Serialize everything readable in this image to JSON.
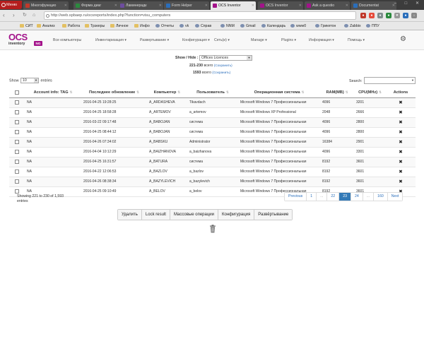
{
  "browser": {
    "menu_label": "Меню",
    "tabs": [
      {
        "title": "Многофункцио",
        "color": "#c0392b",
        "active": false
      },
      {
        "title": "Форма диаг",
        "color": "#2b8a3e",
        "active": false
      },
      {
        "title": "Ламинерадк",
        "color": "#6d4c9f",
        "active": false
      },
      {
        "title": "Form Helper",
        "color": "#2a6ebb",
        "active": false
      },
      {
        "title": "OCS Inventor",
        "color": "#a3128a",
        "active": true
      },
      {
        "title": "OCS Inventor",
        "color": "#a3128a",
        "active": false
      },
      {
        "title": "Ask a questio",
        "color": "#a3128a",
        "active": false
      },
      {
        "title": "Documentat",
        "color": "#2a6ebb",
        "active": false
      }
    ],
    "window_controls": "– □ ✕",
    "url": "http://web.spbaep.ru/ocsreports/index.php?function=visu_computers",
    "bookmarks": [
      "СИТ",
      "Анализ",
      "Работа",
      "Трэкеры",
      "Личное",
      "Инфо",
      "Отчеты",
      "vk",
      "Справ",
      "NNM",
      "Gmail",
      "Календарь",
      "www0",
      "Грикетон",
      "Zabbix",
      "ППУ"
    ]
  },
  "logo": {
    "main": "OCS",
    "sub": "inventory",
    "badge": "NG"
  },
  "nav": [
    "Все компьютеры",
    "Инвентаризация ▾",
    "Развертывание ▾",
    "Конфигурация ▾",
    "Сеть(и) ▾",
    "Manage ▾",
    "Plugins ▾",
    "Информация ▾",
    "Помощь ▾"
  ],
  "filter": {
    "show_hide_label": "Show / Hide :",
    "selected": "Offices Licences",
    "range_count": "221-230",
    "range_suffix": "всего",
    "range_save": "(Сохранить)",
    "total_count": "1593",
    "total_suffix": "всего",
    "total_save": "(Сохранить)"
  },
  "length": {
    "show": "Show",
    "value": "10",
    "entries": "entries"
  },
  "search": {
    "label": "Search:",
    "value": ""
  },
  "table": {
    "columns": [
      "Account info: TAG",
      "Последнее обновление",
      "Компьютер",
      "Пользователь",
      "Операционная система",
      "RAM(MB)",
      "CPU(MHz)",
      "Actions"
    ],
    "rows": [
      [
        "NA",
        "2016-04-25 19:28:25",
        "A_ARDASHEVA",
        "Tikavdach",
        "Microsoft Windows 7 Профессиональная",
        "4096",
        "3201"
      ],
      [
        "NA",
        "2016-04-25 18:58:28",
        "A_ARTEMOV",
        "a_artemov",
        "Microsoft Windows XP Professional",
        "2048",
        "2666"
      ],
      [
        "NA",
        "2016-03-22 09:17:48",
        "A_BABOJAN",
        "система",
        "Microsoft Windows 7 Профессиональная",
        "4096",
        "2800"
      ],
      [
        "NA",
        "2016-04-25 08:44:12",
        "A_BABOJAN",
        "система",
        "Microsoft Windows 7 Профессиональная",
        "4096",
        "2800"
      ],
      [
        "NA",
        "2016-04-26 07:34:02",
        "A_BABSKU",
        "Administrator",
        "Microsoft Windows 7 Профессиональная",
        "16384",
        "2901"
      ],
      [
        "NA",
        "2016-04-04 10:12:29",
        "A_BAIZHANOVA",
        "a_baizhanova",
        "Microsoft Windows 7 Профессиональная",
        "4096",
        "3301"
      ],
      [
        "NA",
        "2016-04-25 16:31:57",
        "A_BATURA",
        "система",
        "Microsoft Windows 7 Профессиональная",
        "8192",
        "3601"
      ],
      [
        "NA",
        "2016-04-22 12:06:53",
        "A_BAZLOV",
        "a_bazlov",
        "Microsoft Windows 7 Профессиональная",
        "8192",
        "3601"
      ],
      [
        "NA",
        "2016-04-26 08:38:34",
        "A_BAZYLEVICH",
        "a_bazylevich",
        "Microsoft Windows 7 Профессиональная",
        "8192",
        "3601"
      ],
      [
        "NA",
        "2016-04-25 09:10:49",
        "A_BELOV",
        "a_belov",
        "Microsoft Windows 7 Профессиональная",
        "8192",
        "3601"
      ]
    ],
    "action_glyph": "✖"
  },
  "info": "Showing 221 to 230 of 1,593 entries",
  "pagination": [
    "Previous",
    "1",
    "...",
    "22",
    "23",
    "24",
    "...",
    "160",
    "Next"
  ],
  "pagination_active": "23",
  "actions": [
    "Удалить",
    "Lock result",
    "Массовые операции",
    "Конфигурация",
    "Развёртывание"
  ]
}
